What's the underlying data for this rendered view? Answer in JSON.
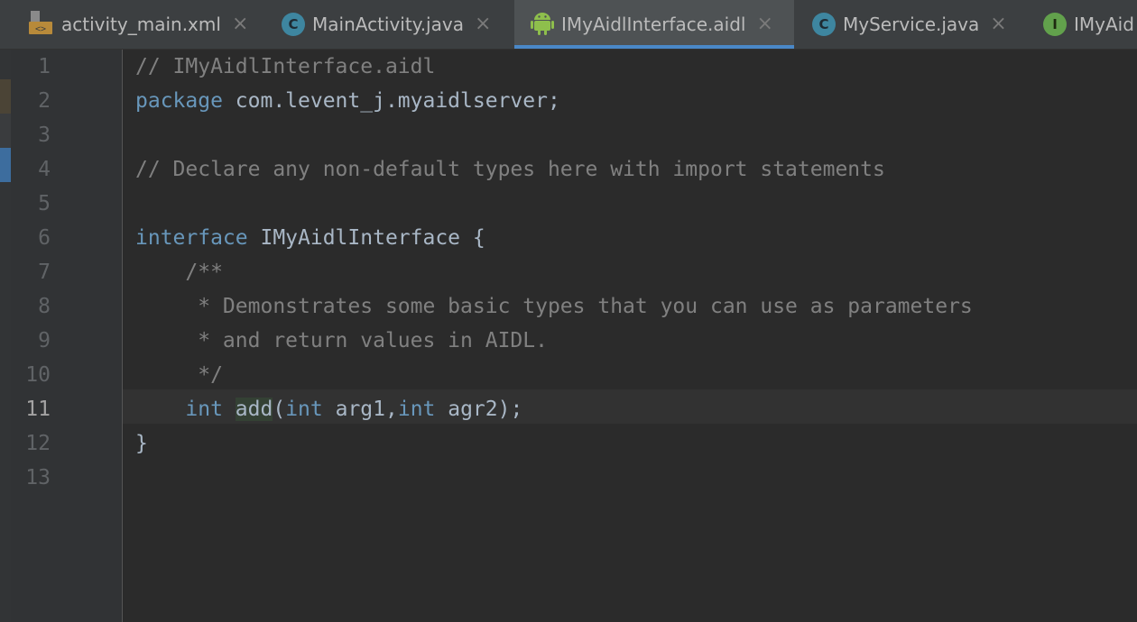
{
  "tabs": [
    {
      "label": "activity_main.xml",
      "icon": "xml-layout-icon",
      "closable": true,
      "active": false
    },
    {
      "label": "MainActivity.java",
      "icon": "class-icon",
      "icon_glyph": "C",
      "closable": true,
      "active": false
    },
    {
      "label": "IMyAidlInterface.aidl",
      "icon": "android-icon",
      "closable": true,
      "active": true
    },
    {
      "label": "MyService.java",
      "icon": "class-icon",
      "icon_glyph": "C",
      "closable": true,
      "active": false
    },
    {
      "label": "IMyAid",
      "icon": "interface-icon",
      "icon_glyph": "I",
      "closable": false,
      "active": false
    }
  ],
  "close_glyph": "×",
  "line_numbers": [
    "1",
    "2",
    "3",
    "4",
    "5",
    "6",
    "7",
    "8",
    "9",
    "10",
    "11",
    "12",
    "13"
  ],
  "current_line": 11,
  "code": {
    "l1": "// IMyAidlInterface.aidl",
    "l2_kw": "package",
    "l2_rest": " com.levent_j.myaidlserver;",
    "l4": "// Declare any non-default types here with import statements",
    "l6_kw": "interface",
    "l6_rest": " IMyAidlInterface {",
    "l7": "    /**",
    "l8": "     * Demonstrates some basic types that you can use as parameters",
    "l9": "     * and return values in AIDL.",
    "l10": "     */",
    "l11_indent": "    ",
    "l11_kw1": "int",
    "l11_sp": " ",
    "l11_method": "add",
    "l11_paren": "(",
    "l11_kw2": "int",
    "l11_arg1": " arg1,",
    "l11_kw3": "int",
    "l11_arg2": " agr2);",
    "l12": "}"
  },
  "colors": {
    "background": "#2b2b2b",
    "comment": "#808080",
    "keyword": "#6897bb",
    "text": "#a9b7c6",
    "active_tab_underline": "#4a88c7"
  }
}
